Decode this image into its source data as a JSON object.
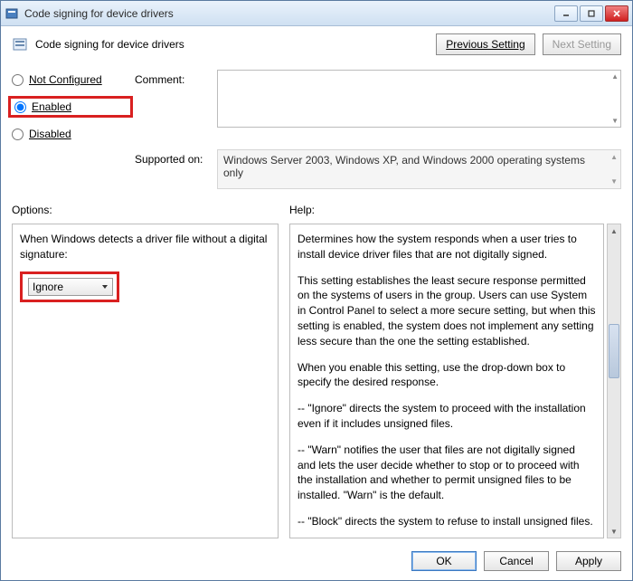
{
  "window": {
    "title": "Code signing for device drivers"
  },
  "header": {
    "title": "Code signing for device drivers",
    "prev_label": "Previous Setting",
    "next_label": "Next Setting"
  },
  "state_radios": {
    "not_configured": "Not Configured",
    "enabled": "Enabled",
    "disabled": "Disabled",
    "selected": "enabled"
  },
  "labels": {
    "comment": "Comment:",
    "supported_on": "Supported on:",
    "options": "Options:",
    "help": "Help:"
  },
  "supported_text": "Windows Server 2003, Windows XP, and Windows 2000 operating systems only",
  "options": {
    "detect_label": "When Windows detects a driver file without a digital signature:",
    "dropdown_value": "Ignore"
  },
  "help": {
    "p1": "Determines how the system responds when a user tries to install device driver files that are not digitally signed.",
    "p2": "This setting establishes the least secure response permitted on the systems of users in the group. Users can use System in Control Panel to select a more secure setting, but when this setting is enabled, the system does not implement any setting less secure than the one the setting established.",
    "p3": "When you enable this setting, use the drop-down box to specify the desired response.",
    "p4": "--   \"Ignore\" directs the system to proceed with the installation even if it includes unsigned files.",
    "p5": "--   \"Warn\" notifies the user that files are not digitally signed and lets the user decide whether to stop or to proceed with the installation and whether to permit unsigned files to be installed. \"Warn\" is the default.",
    "p6": "--   \"Block\" directs the system to refuse to install unsigned files."
  },
  "buttons": {
    "ok": "OK",
    "cancel": "Cancel",
    "apply": "Apply"
  }
}
